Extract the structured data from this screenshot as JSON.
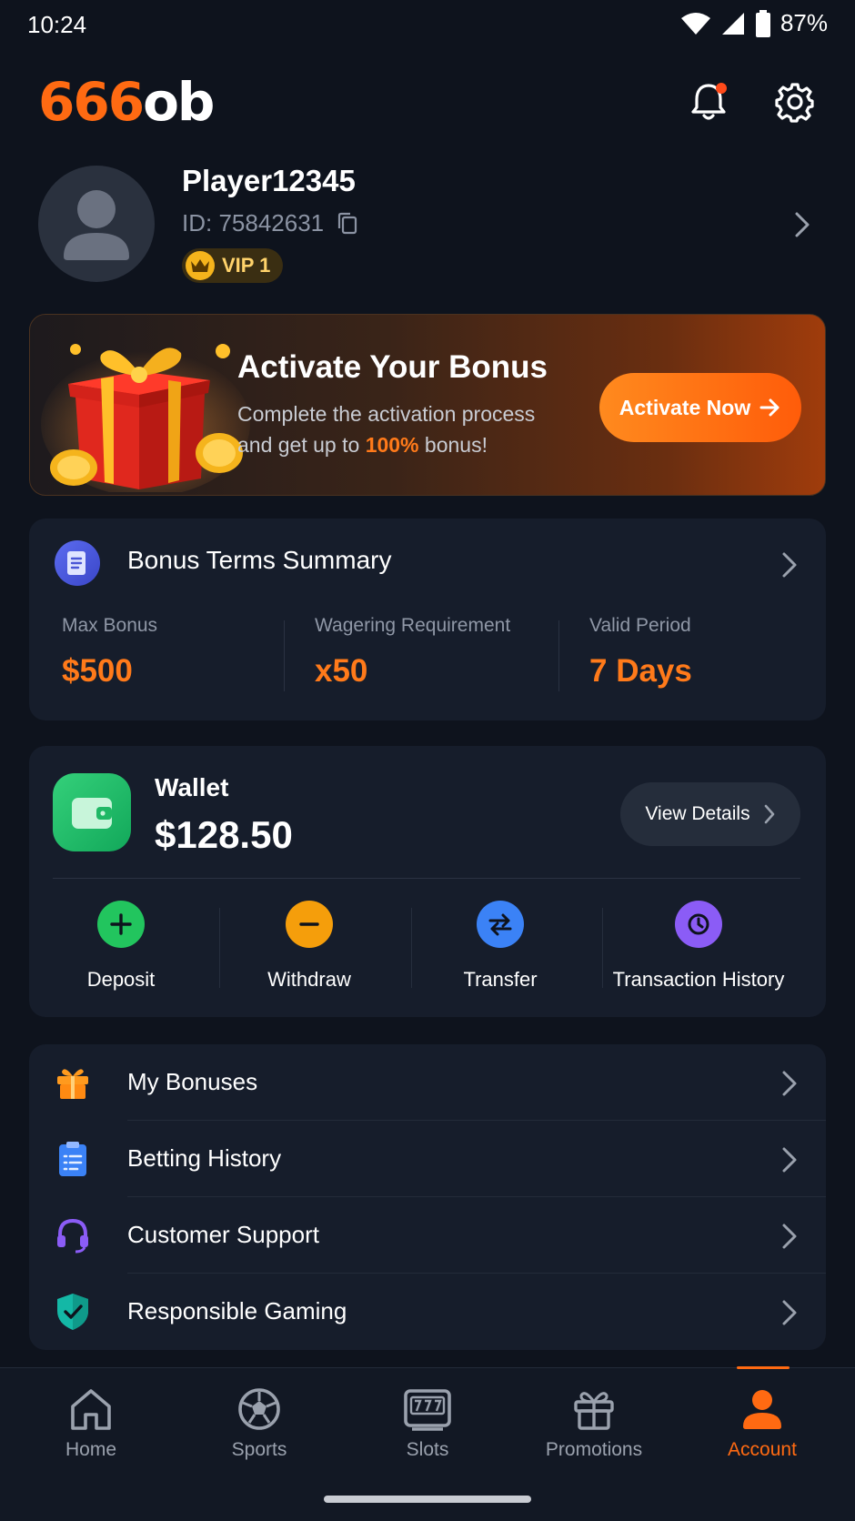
{
  "status_bar": {
    "time": "10:24",
    "battery": "87%"
  },
  "header": {
    "logo_part1": "666",
    "logo_part2": "ob"
  },
  "profile": {
    "username": "Player12345",
    "id_text": "ID: 75842631",
    "vip_label": "VIP 1"
  },
  "banner": {
    "title": "Activate Your Bonus",
    "desc_line1": "Complete the activation process",
    "desc_before_pct": "and get up to ",
    "desc_pct": "100%",
    "desc_after_pct": " bonus!",
    "button_label": "Activate Now"
  },
  "terms": {
    "title": "Bonus Terms Summary",
    "stats": [
      {
        "label": "Max Bonus",
        "value": "$500"
      },
      {
        "label": "Wagering Requirement",
        "value": "x50"
      },
      {
        "label": "Valid Period",
        "value": "7 Days"
      }
    ]
  },
  "wallet": {
    "title": "Wallet",
    "balance": "$128.50",
    "view_details_label": "View Details",
    "actions": [
      {
        "label": "Deposit",
        "color": "#22c55e"
      },
      {
        "label": "Withdraw",
        "color": "#f59e0b"
      },
      {
        "label": "Transfer",
        "color": "#3b82f6"
      },
      {
        "label": "Transaction History",
        "color": "#8b5cf6"
      }
    ]
  },
  "menu": {
    "items": [
      {
        "label": "My Bonuses",
        "icon": "gift-icon"
      },
      {
        "label": "Betting History",
        "icon": "clipboard-icon"
      },
      {
        "label": "Customer Support",
        "icon": "headset-icon"
      },
      {
        "label": "Responsible Gaming",
        "icon": "shield-check-icon"
      }
    ]
  },
  "nav": {
    "items": [
      {
        "label": "Home",
        "icon": "home-icon"
      },
      {
        "label": "Sports",
        "icon": "soccer-ball-icon"
      },
      {
        "label": "Slots",
        "icon": "slot-machine-icon"
      },
      {
        "label": "Promotions",
        "icon": "gift-icon"
      },
      {
        "label": "Account",
        "icon": "user-icon"
      }
    ],
    "active": "Account",
    "accent_color": "#ff6a12"
  }
}
